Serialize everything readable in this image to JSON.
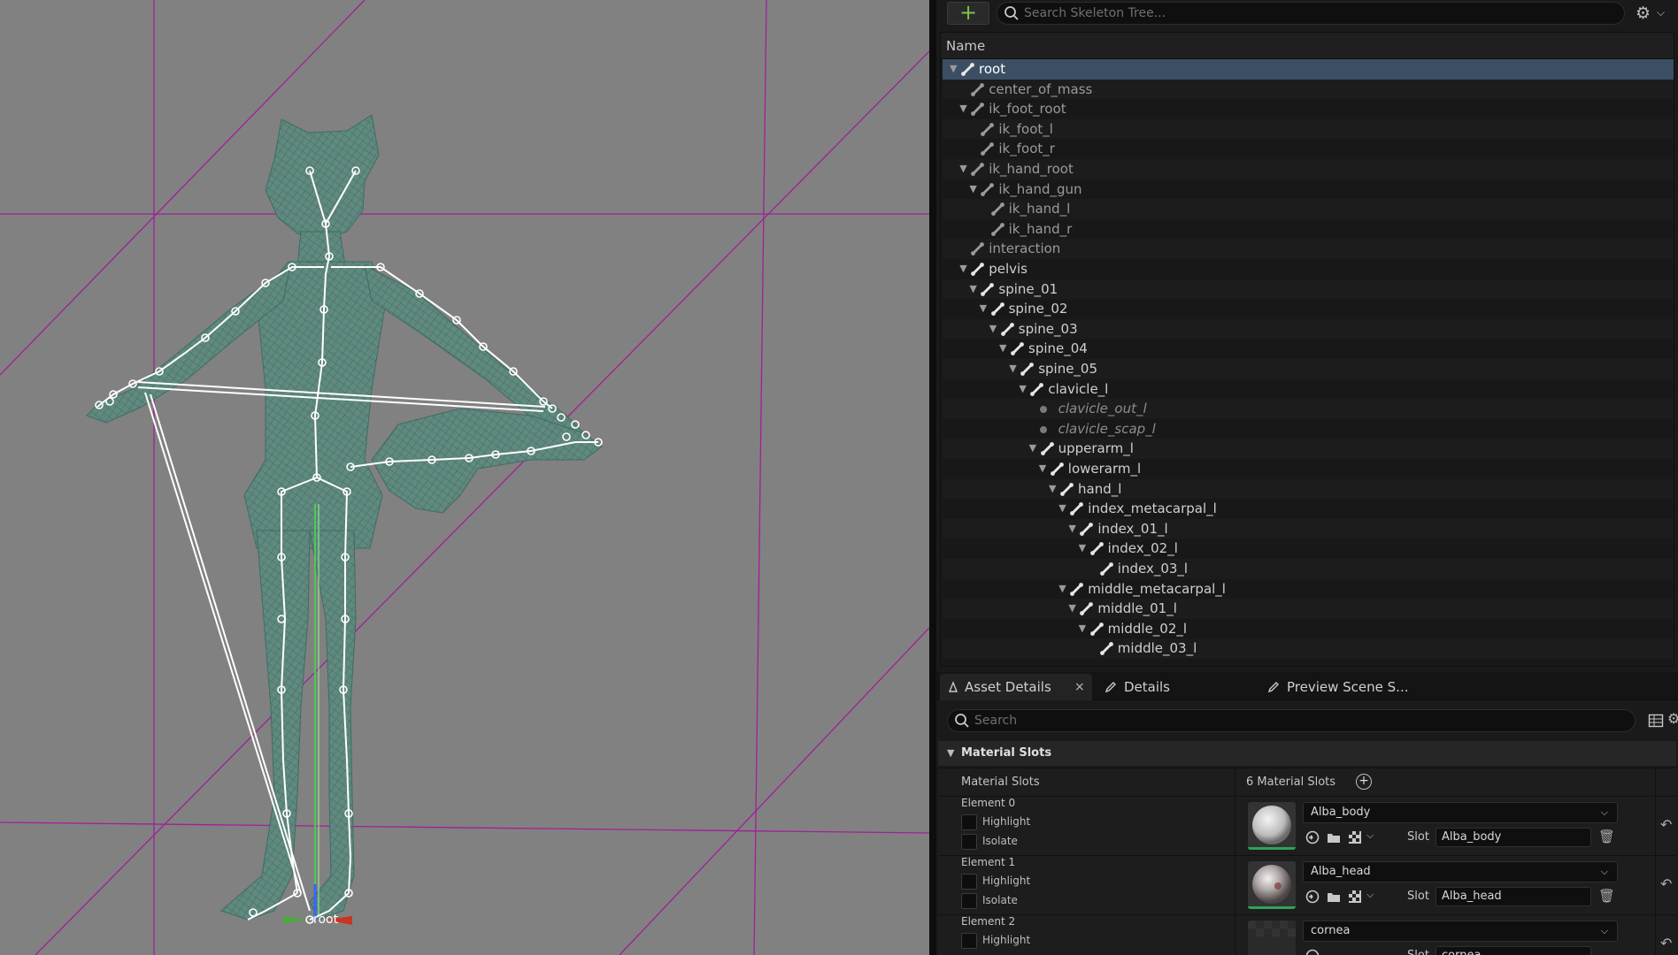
{
  "viewport": {
    "root_label": "root"
  },
  "skeleton_panel": {
    "search_placeholder": "Search Skeleton Tree...",
    "column_name": "Name",
    "rows": [
      {
        "label": "root",
        "depth": 0,
        "expanded": true,
        "kind": "bone",
        "selected": true
      },
      {
        "label": "center_of_mass",
        "depth": 1,
        "expanded": null,
        "kind": "bone-muted"
      },
      {
        "label": "ik_foot_root",
        "depth": 1,
        "expanded": true,
        "kind": "bone-muted"
      },
      {
        "label": "ik_foot_l",
        "depth": 2,
        "expanded": null,
        "kind": "bone-muted"
      },
      {
        "label": "ik_foot_r",
        "depth": 2,
        "expanded": null,
        "kind": "bone-muted"
      },
      {
        "label": "ik_hand_root",
        "depth": 1,
        "expanded": true,
        "kind": "bone-muted"
      },
      {
        "label": "ik_hand_gun",
        "depth": 2,
        "expanded": true,
        "kind": "bone-muted"
      },
      {
        "label": "ik_hand_l",
        "depth": 3,
        "expanded": null,
        "kind": "bone-muted"
      },
      {
        "label": "ik_hand_r",
        "depth": 3,
        "expanded": null,
        "kind": "bone-muted"
      },
      {
        "label": "interaction",
        "depth": 1,
        "expanded": null,
        "kind": "bone-muted"
      },
      {
        "label": "pelvis",
        "depth": 1,
        "expanded": true,
        "kind": "bone"
      },
      {
        "label": "spine_01",
        "depth": 2,
        "expanded": true,
        "kind": "bone"
      },
      {
        "label": "spine_02",
        "depth": 3,
        "expanded": true,
        "kind": "bone"
      },
      {
        "label": "spine_03",
        "depth": 4,
        "expanded": true,
        "kind": "bone"
      },
      {
        "label": "spine_04",
        "depth": 5,
        "expanded": true,
        "kind": "bone"
      },
      {
        "label": "spine_05",
        "depth": 6,
        "expanded": true,
        "kind": "bone"
      },
      {
        "label": "clavicle_l",
        "depth": 7,
        "expanded": true,
        "kind": "bone"
      },
      {
        "label": "clavicle_out_l",
        "depth": 8,
        "expanded": null,
        "kind": "socket"
      },
      {
        "label": "clavicle_scap_l",
        "depth": 8,
        "expanded": null,
        "kind": "socket"
      },
      {
        "label": "upperarm_l",
        "depth": 8,
        "expanded": true,
        "kind": "bone"
      },
      {
        "label": "lowerarm_l",
        "depth": 9,
        "expanded": true,
        "kind": "bone"
      },
      {
        "label": "hand_l",
        "depth": 10,
        "expanded": true,
        "kind": "bone"
      },
      {
        "label": "index_metacarpal_l",
        "depth": 11,
        "expanded": true,
        "kind": "bone"
      },
      {
        "label": "index_01_l",
        "depth": 12,
        "expanded": true,
        "kind": "bone"
      },
      {
        "label": "index_02_l",
        "depth": 13,
        "expanded": true,
        "kind": "bone"
      },
      {
        "label": "index_03_l",
        "depth": 14,
        "expanded": null,
        "kind": "bone"
      },
      {
        "label": "middle_metacarpal_l",
        "depth": 11,
        "expanded": true,
        "kind": "bone"
      },
      {
        "label": "middle_01_l",
        "depth": 12,
        "expanded": true,
        "kind": "bone"
      },
      {
        "label": "middle_02_l",
        "depth": 13,
        "expanded": true,
        "kind": "bone"
      },
      {
        "label": "middle_03_l",
        "depth": 14,
        "expanded": null,
        "kind": "bone"
      }
    ]
  },
  "tabs": {
    "asset_details": "Asset Details",
    "close": "×",
    "details": "Details",
    "preview_scene": "Preview Scene S..."
  },
  "details": {
    "search_placeholder": "Search",
    "section_title": "Material Slots",
    "slots_label": "Material Slots",
    "slots_count": "6 Material Slots",
    "highlight_label": "Highlight",
    "isolate_label": "Isolate",
    "slot_label": "Slot",
    "elements": [
      {
        "name": "Element 0",
        "material": "Alba_body",
        "slot": "Alba_body"
      },
      {
        "name": "Element 1",
        "material": "Alba_head",
        "slot": "Alba_head"
      },
      {
        "name": "Element 2",
        "material": "cornea",
        "slot": "cornea"
      }
    ]
  },
  "colors": {
    "accent_green": "#7cc24a",
    "selection": "#3c4e64",
    "viewport_bg": "#818181",
    "grid_line": "#a0209a",
    "mesh": "#4a7f72"
  }
}
